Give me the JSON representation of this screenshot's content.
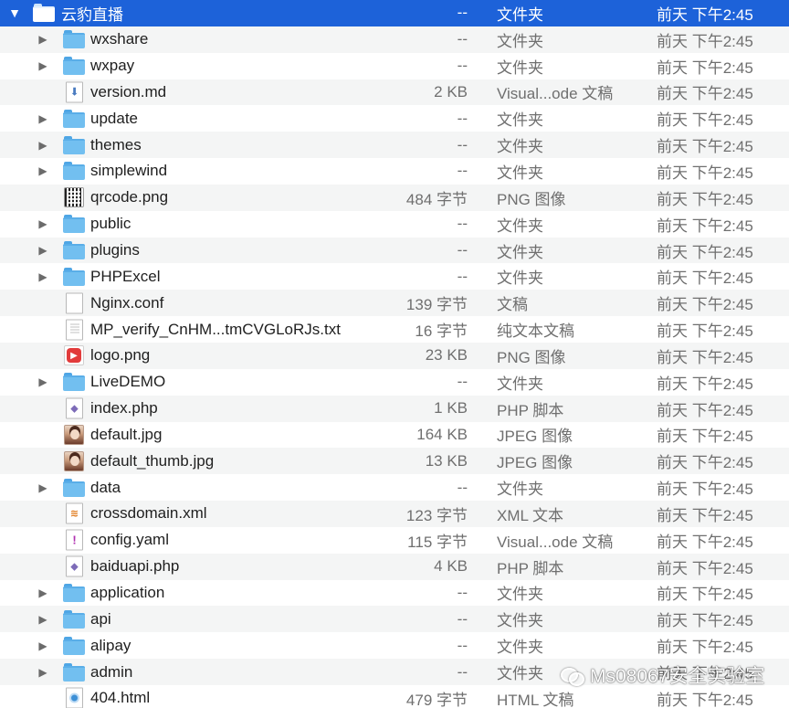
{
  "root": {
    "name": "云豹直播",
    "size": "--",
    "kind": "文件夹",
    "date": "前天 下午2:45"
  },
  "rows": [
    {
      "type": "folder",
      "name": "wxshare",
      "size": "--",
      "kind": "文件夹",
      "date": "前天 下午2:45",
      "icon": "folder-icon"
    },
    {
      "type": "folder",
      "name": "wxpay",
      "size": "--",
      "kind": "文件夹",
      "date": "前天 下午2:45",
      "icon": "folder-icon"
    },
    {
      "type": "file",
      "name": "version.md",
      "size": "2 KB",
      "kind": "Visual...ode 文稿",
      "date": "前天 下午2:45",
      "icon": "markdown-file-icon"
    },
    {
      "type": "folder",
      "name": "update",
      "size": "--",
      "kind": "文件夹",
      "date": "前天 下午2:45",
      "icon": "folder-icon"
    },
    {
      "type": "folder",
      "name": "themes",
      "size": "--",
      "kind": "文件夹",
      "date": "前天 下午2:45",
      "icon": "folder-icon"
    },
    {
      "type": "folder",
      "name": "simplewind",
      "size": "--",
      "kind": "文件夹",
      "date": "前天 下午2:45",
      "icon": "folder-icon"
    },
    {
      "type": "file",
      "name": "qrcode.png",
      "size": "484 字节",
      "kind": "PNG 图像",
      "date": "前天 下午2:45",
      "icon": "qrcode-image-icon"
    },
    {
      "type": "folder",
      "name": "public",
      "size": "--",
      "kind": "文件夹",
      "date": "前天 下午2:45",
      "icon": "folder-icon"
    },
    {
      "type": "folder",
      "name": "plugins",
      "size": "--",
      "kind": "文件夹",
      "date": "前天 下午2:45",
      "icon": "folder-icon"
    },
    {
      "type": "folder",
      "name": "PHPExcel",
      "size": "--",
      "kind": "文件夹",
      "date": "前天 下午2:45",
      "icon": "folder-icon"
    },
    {
      "type": "file",
      "name": "Nginx.conf",
      "size": "139 字节",
      "kind": "文稿",
      "date": "前天 下午2:45",
      "icon": "blank-document-icon"
    },
    {
      "type": "file",
      "name": "MP_verify_CnHM...tmCVGLoRJs.txt",
      "size": "16 字节",
      "kind": "纯文本文稿",
      "date": "前天 下午2:45",
      "icon": "text-file-icon"
    },
    {
      "type": "file",
      "name": "logo.png",
      "size": "23 KB",
      "kind": "PNG 图像",
      "date": "前天 下午2:45",
      "icon": "logo-image-icon"
    },
    {
      "type": "folder",
      "name": "LiveDEMO",
      "size": "--",
      "kind": "文件夹",
      "date": "前天 下午2:45",
      "icon": "folder-icon"
    },
    {
      "type": "file",
      "name": "index.php",
      "size": "1 KB",
      "kind": "PHP 脚本",
      "date": "前天 下午2:45",
      "icon": "php-file-icon"
    },
    {
      "type": "file",
      "name": "default.jpg",
      "size": "164 KB",
      "kind": "JPEG 图像",
      "date": "前天 下午2:45",
      "icon": "photo-image-icon"
    },
    {
      "type": "file",
      "name": "default_thumb.jpg",
      "size": "13 KB",
      "kind": "JPEG 图像",
      "date": "前天 下午2:45",
      "icon": "photo-image-icon"
    },
    {
      "type": "folder",
      "name": "data",
      "size": "--",
      "kind": "文件夹",
      "date": "前天 下午2:45",
      "icon": "folder-icon"
    },
    {
      "type": "file",
      "name": "crossdomain.xml",
      "size": "123 字节",
      "kind": "XML 文本",
      "date": "前天 下午2:45",
      "icon": "xml-file-icon"
    },
    {
      "type": "file",
      "name": "config.yaml",
      "size": "115 字节",
      "kind": "Visual...ode 文稿",
      "date": "前天 下午2:45",
      "icon": "yaml-file-icon"
    },
    {
      "type": "file",
      "name": "baiduapi.php",
      "size": "4 KB",
      "kind": "PHP 脚本",
      "date": "前天 下午2:45",
      "icon": "php-file-icon"
    },
    {
      "type": "folder",
      "name": "application",
      "size": "--",
      "kind": "文件夹",
      "date": "前天 下午2:45",
      "icon": "folder-icon"
    },
    {
      "type": "folder",
      "name": "api",
      "size": "--",
      "kind": "文件夹",
      "date": "前天 下午2:45",
      "icon": "folder-icon"
    },
    {
      "type": "folder",
      "name": "alipay",
      "size": "--",
      "kind": "文件夹",
      "date": "前天 下午2:45",
      "icon": "folder-icon"
    },
    {
      "type": "folder",
      "name": "admin",
      "size": "--",
      "kind": "文件夹",
      "date": "前天 下午2:45",
      "icon": "folder-icon"
    },
    {
      "type": "file",
      "name": "404.html",
      "size": "479 字节",
      "kind": "HTML 文稿",
      "date": "前天 下午2:45",
      "icon": "html-file-icon"
    }
  ],
  "watermark": {
    "text": "Ms08067安全实验室"
  },
  "colors": {
    "selection": "#1d62d9",
    "alt_row": "#f4f5f5",
    "folder": "#72bff0"
  }
}
